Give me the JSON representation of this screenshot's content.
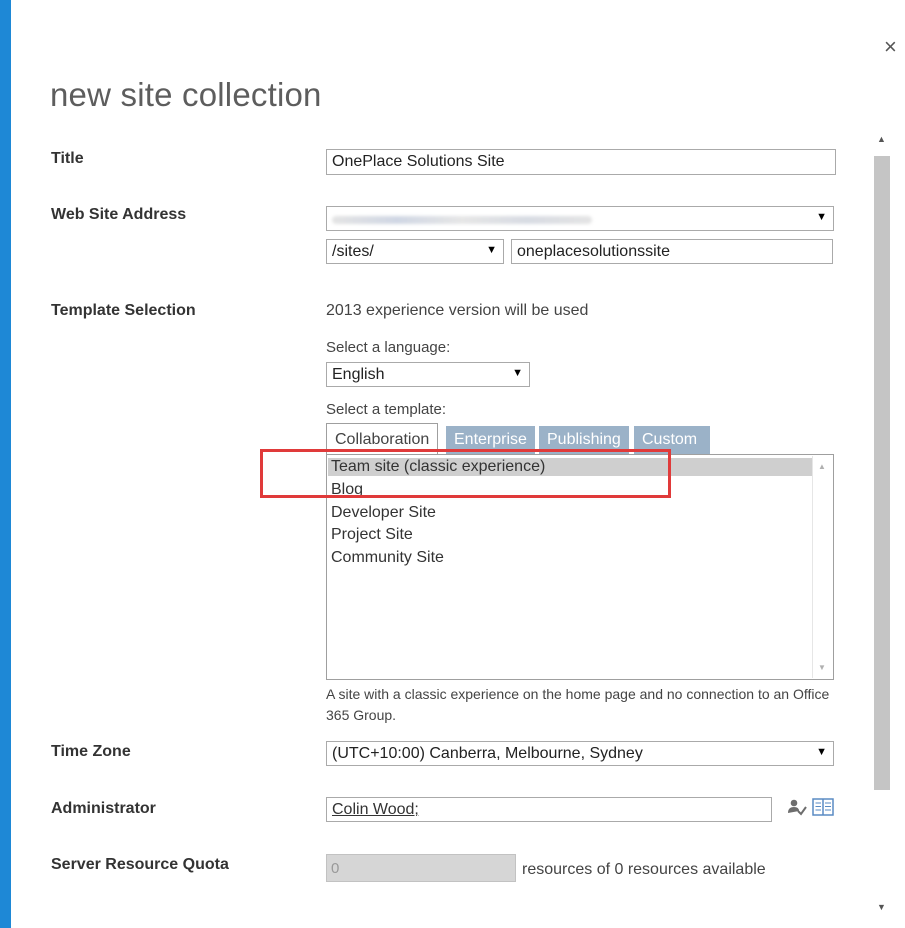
{
  "dialog": {
    "title": "new site collection",
    "close_label": "×"
  },
  "fields": {
    "title": {
      "label": "Title",
      "value": "OnePlace Solutions Site"
    },
    "web_site_address": {
      "label": "Web Site Address",
      "domain_value": "",
      "path_prefix": "/sites/",
      "url_name": "oneplacesolutionssite"
    },
    "template_selection": {
      "label": "Template Selection",
      "experience_note": "2013 experience version will be used",
      "language_prompt": "Select a language:",
      "language_value": "English",
      "template_prompt": "Select a template:",
      "tabs": [
        {
          "label": "Collaboration"
        },
        {
          "label": "Enterprise"
        },
        {
          "label": "Publishing"
        },
        {
          "label": "Custom"
        }
      ],
      "templates": [
        {
          "label": "Team site (classic experience)"
        },
        {
          "label": "Blog"
        },
        {
          "label": "Developer Site"
        },
        {
          "label": "Project Site"
        },
        {
          "label": "Community Site"
        }
      ],
      "description": "A site with a classic experience on the home page and no connection to an Office 365 Group."
    },
    "time_zone": {
      "label": "Time Zone",
      "value": "(UTC+10:00) Canberra, Melbourne, Sydney"
    },
    "administrator": {
      "label": "Administrator",
      "value": "Colin Wood;"
    },
    "quota": {
      "label": "Server Resource Quota",
      "value": "0",
      "suffix": "resources of 0 resources available"
    }
  },
  "colors": {
    "accent": "#1e88d6",
    "tab_inactive": "#9bb2c8",
    "highlight": "#e03a3a",
    "selected_item": "#cfcfcf"
  },
  "icons": {
    "close": "close-icon",
    "check_names": "check-names-icon",
    "browse": "address-book-icon",
    "dropdown": "chevron-down-icon"
  }
}
